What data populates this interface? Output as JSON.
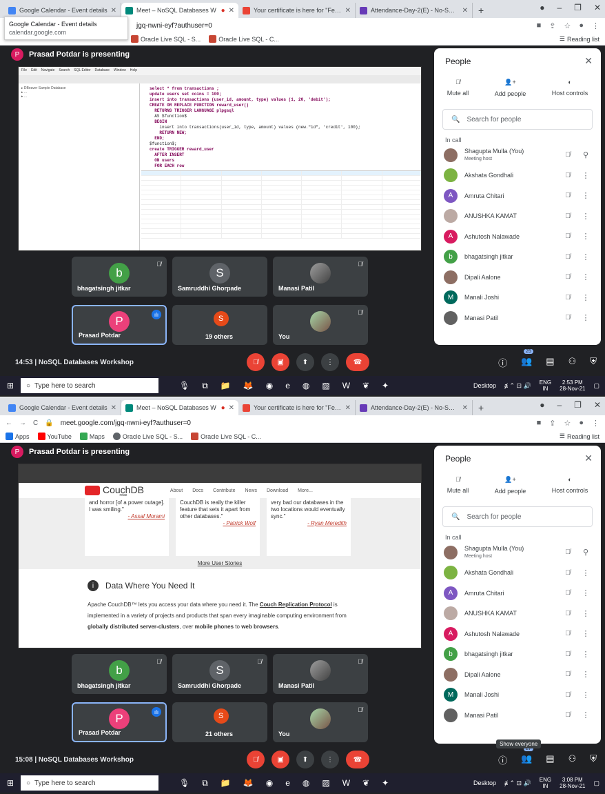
{
  "screens": [
    {
      "tabs": [
        "Google Calendar - Event details",
        "Meet – NoSQL Databases W",
        "Your certificate is here for \"Feedl",
        "Attendance-Day-2(E) - No-SQL V"
      ],
      "tooltip_title": "Google Calendar - Event details",
      "tooltip_sub": "calendar.google.com",
      "url": "jgq-nwni-eyf?authuser=0",
      "bookmarks": [
        "Oracle Live SQL - S...",
        "Oracle Live SQL - C..."
      ],
      "reading_list": "Reading list",
      "presenter_banner": "Prasad Potdar is presenting",
      "tiles": [
        "bhagatsingh jitkar",
        "Samruddhi Ghorpade",
        "Manasi Patil",
        "Prasad Potdar",
        "19 others",
        "You"
      ],
      "time_title": "14:53 | NoSQL Databases Workshop",
      "people_count": "25",
      "taskbar": {
        "search": "Type here to search",
        "desktop": "Desktop",
        "lang": "ENG\nIN",
        "time": "2:53 PM",
        "date": "28-Nov-21"
      }
    },
    {
      "tabs": [
        "Google Calendar - Event details",
        "Meet – NoSQL Databases W",
        "Your certificate is here for \"Feedl",
        "Attendance-Day-2(E) - No-SQL V"
      ],
      "url": "meet.google.com/jgq-nwni-eyf?authuser=0",
      "bookmarks": [
        "Apps",
        "YouTube",
        "Maps",
        "Oracle Live SQL - S...",
        "Oracle Live SQL - C..."
      ],
      "reading_list": "Reading list",
      "presenter_banner": "Prasad Potdar is presenting",
      "tiles": [
        "bhagatsingh jitkar",
        "Samruddhi Ghorpade",
        "Manasi Patil",
        "Prasad Potdar",
        "21 others",
        "You"
      ],
      "time_title": "15:08 | NoSQL Databases Workshop",
      "people_count": "27",
      "show_everyone": "Show everyone",
      "taskbar": {
        "search": "Type here to search",
        "desktop": "Desktop",
        "lang": "ENG\nIN",
        "time": "3:08 PM",
        "date": "28-Nov-21"
      }
    }
  ],
  "people_panel": {
    "title": "People",
    "actions": [
      "Mute all",
      "Add people",
      "Host controls"
    ],
    "search_placeholder": "Search for people",
    "section": "In call",
    "meeting_host": "Meeting host",
    "participants": [
      {
        "name": "Shagupta Mulla (You)",
        "initial": "",
        "color": "#8d6e63"
      },
      {
        "name": "Akshata Gondhali",
        "initial": "",
        "color": "#7cb342"
      },
      {
        "name": "Amruta Chitari",
        "initial": "A",
        "color": "#7e57c2"
      },
      {
        "name": "ANUSHKA KAMAT",
        "initial": "",
        "color": "#bcaaa4"
      },
      {
        "name": "Ashutosh Nalawade",
        "initial": "A",
        "color": "#d81b60"
      },
      {
        "name": "bhagatsingh jitkar",
        "initial": "b",
        "color": "#43a047"
      },
      {
        "name": "Dipali Aalone",
        "initial": "",
        "color": "#8d6e63"
      },
      {
        "name": "Manali Joshi",
        "initial": "M",
        "color": "#00695c"
      },
      {
        "name": "Manasi Patil",
        "initial": "",
        "color": "#616161"
      }
    ]
  },
  "shared_screen_1": {
    "code_lines": [
      "select * from transactions ;",
      "update users set coins = 100;",
      "",
      "insert into transactions (user_id, amount, type) values (1, 20, 'debit');",
      "",
      "CREATE OR REPLACE FUNCTION reward_user()",
      "  RETURNS TRIGGER LANGUAGE plpgsql",
      "  AS $function$",
      "  BEGIN",
      "    insert into transactions(user_id, type, amount) values (new.\"id\", 'credit', 100);",
      "    RETURN NEW;",
      "  END;",
      "$function$;",
      "",
      "create TRIGGER reward_user",
      "  AFTER INSERT",
      "  ON users",
      "  FOR EACH row"
    ]
  },
  "shared_screen_2": {
    "brand": "CouchDB",
    "brand_sub": "relax",
    "nav": [
      "About",
      "Docs",
      "Contribute",
      "News",
      "Download",
      "More..."
    ],
    "quotes": [
      {
        "text": "and horror [of a power outage]. I was smiling.\"",
        "author": "- Assaf Morami"
      },
      {
        "text": "CouchDB is really the killer feature that sets it apart from other databases.\"",
        "author": "- Patrick Wolf"
      },
      {
        "text": "very bad our databases in the two locations would eventually sync.\"",
        "author": "- Ryan Meredith"
      }
    ],
    "more_stories": "More User Stories",
    "heading": "Data Where You Need It",
    "p1": "Apache CouchDB™ lets you access your data where you need it. The ",
    "link1": "Couch Replication Protocol",
    "p2": " is implemented in a variety of projects and products that span every imaginable computing environment from ",
    "b1": "globally distributed server-clusters",
    "p3": ", over ",
    "b2": "mobile phones",
    "p4": " to ",
    "b3": "web browsers",
    "p5": "."
  }
}
